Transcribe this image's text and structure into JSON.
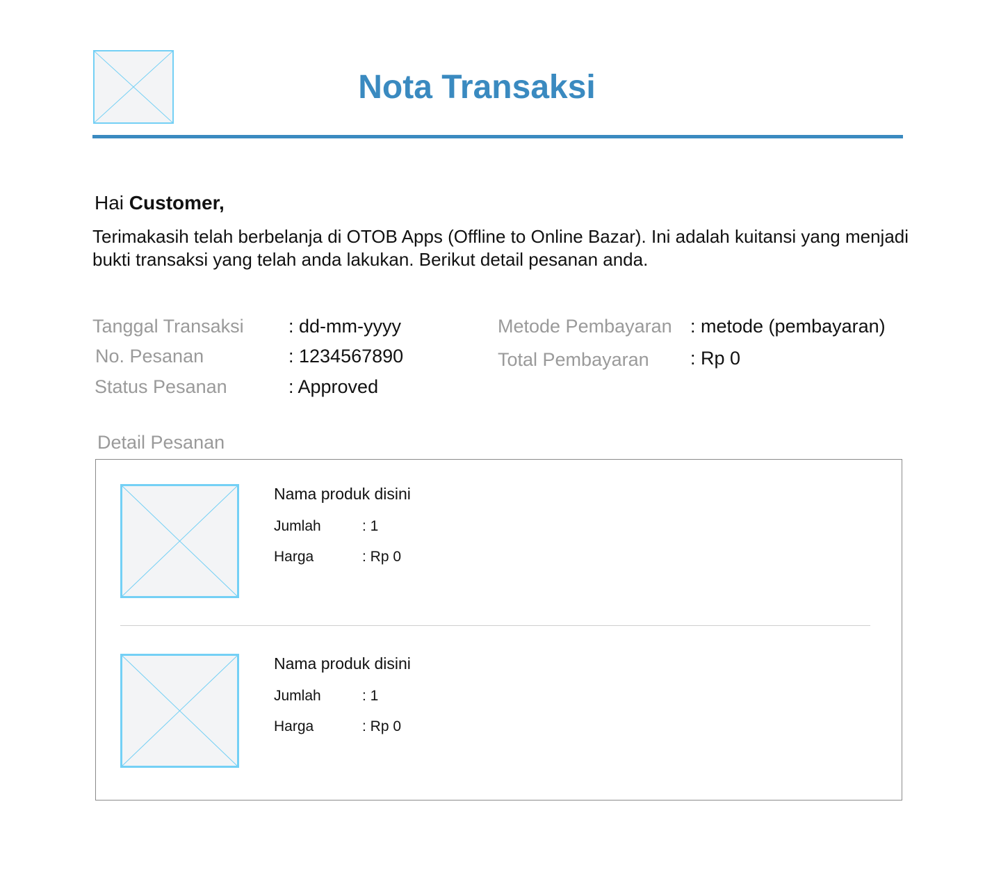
{
  "header": {
    "title": "Nota Transaksi",
    "logo_icon": "image-placeholder-icon",
    "accent_color": "#3a8ac0"
  },
  "greeting": {
    "prefix": "Hai",
    "name": "Customer,"
  },
  "intro": "Terimakasih telah berbelanja di OTOB Apps (Offline to Online Bazar). Ini adalah kuitansi yang menjadi bukti transaksi yang telah anda lakukan. Berikut detail pesanan anda.",
  "info": {
    "tanggal": {
      "label": "Tanggal Transaksi",
      "value": ": dd-mm-yyyy"
    },
    "pesanan": {
      "label": "No. Pesanan",
      "value": ": 1234567890"
    },
    "status": {
      "label": "Status Pesanan",
      "value": ": Approved"
    },
    "metode": {
      "label": "Metode Pembayaran",
      "value": ": metode (pembayaran)"
    },
    "total": {
      "label": "Total Pembayaran",
      "value": ": Rp 0"
    }
  },
  "detail": {
    "title": "Detail Pesanan",
    "items": [
      {
        "name": "Nama produk disini",
        "jumlah_label": "Jumlah",
        "jumlah_value": ": 1",
        "harga_label": "Harga",
        "harga_value": ": Rp 0"
      },
      {
        "name": "Nama produk disini",
        "jumlah_label": "Jumlah",
        "jumlah_value": ": 1",
        "harga_label": "Harga",
        "harga_value": ": Rp 0"
      }
    ]
  }
}
